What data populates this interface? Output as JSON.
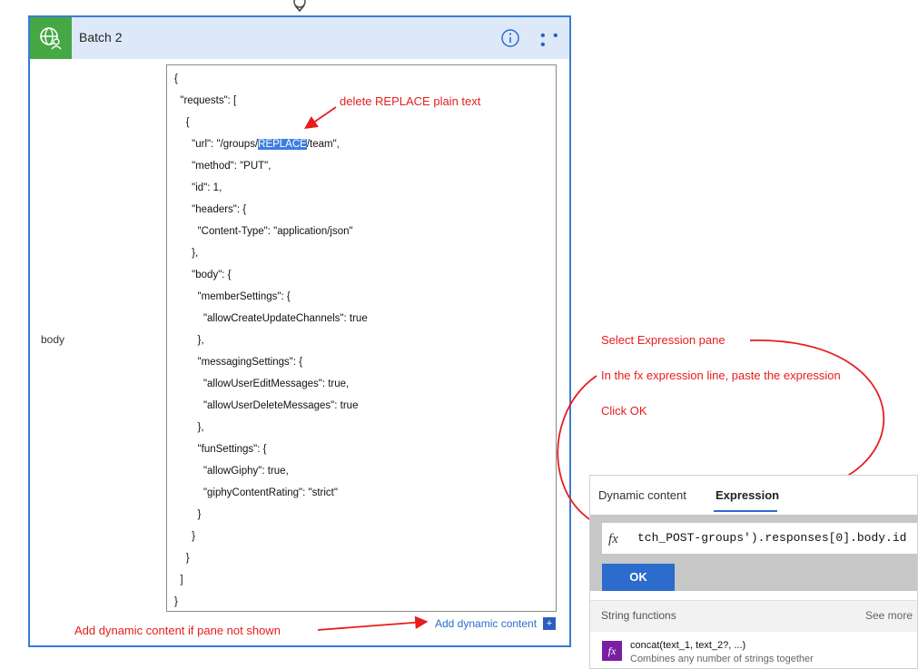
{
  "card": {
    "title": "Batch 2",
    "body_label": "body",
    "code_lines": [
      "{",
      "  \"requests\": [",
      "    {",
      "      \"url\": \"/groups/",
      "      \"method\": \"PUT\",",
      "      \"id\": 1,",
      "      \"headers\": {",
      "        \"Content-Type\": \"application/json\"",
      "      },",
      "      \"body\": {",
      "        \"memberSettings\": {",
      "          \"allowCreateUpdateChannels\": true",
      "        },",
      "        \"messagingSettings\": {",
      "          \"allowUserEditMessages\": true,",
      "          \"allowUserDeleteMessages\": true",
      "        },",
      "        \"funSettings\": {",
      "          \"allowGiphy\": true,",
      "          \"giphyContentRating\": \"strict\"",
      "        }",
      "      }",
      "    }",
      "  ]",
      "}"
    ],
    "url_highlight": "REPLACE",
    "url_tail": "/team\",",
    "add_dynamic_label": "Add dynamic content",
    "add_dynamic_plus": "+"
  },
  "annotations": {
    "delete_replace": "delete REPLACE plain text",
    "select_expression": "Select Expression pane",
    "paste_expression": "In the fx expression line, paste the expression",
    "click_ok": "Click OK",
    "add_dynamic": "Add dynamic content if pane not shown"
  },
  "pane": {
    "tab_dynamic": "Dynamic content",
    "tab_expression": "Expression",
    "fx_symbol": "fx",
    "expression_value": "tch_POST-groups').responses[0].body.id",
    "ok_label": "OK",
    "section_label": "String functions",
    "see_more": "See more",
    "func_name": "concat(text_1, text_2?, ...)",
    "func_desc": "Combines any number of strings together"
  },
  "colors": {
    "accent": "#2b6ccc",
    "annotation": "#e81c1c",
    "icon_green": "#46a844",
    "function_purple": "#7a1fa2"
  },
  "icons": [
    "flow-connector-icon",
    "globe-user-icon",
    "info-icon",
    "more-options-icon",
    "fx-icon",
    "plus-icon"
  ]
}
